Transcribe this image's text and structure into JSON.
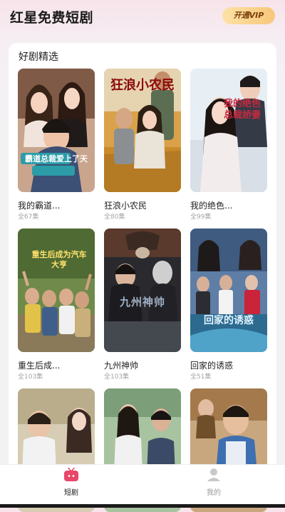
{
  "header": {
    "title": "红星免费短剧",
    "vip_label": "开通VIP"
  },
  "section": {
    "title": "好剧精选"
  },
  "items": [
    {
      "title": "我的霸道...",
      "count": "全67集",
      "poster_text": "霸道总裁爱上了天"
    },
    {
      "title": "狂浪小农民",
      "count": "全80集",
      "poster_text": "狂浪小农民"
    },
    {
      "title": "我的绝色...",
      "count": "全99集",
      "poster_text": "我的绝色总裁娇妻"
    },
    {
      "title": "重生后成...",
      "count": "全103集",
      "poster_text": "重生后成为汽车大亨"
    },
    {
      "title": "九州神帅",
      "count": "全103集",
      "poster_text": "九州神帅"
    },
    {
      "title": "回家的诱惑",
      "count": "全51集",
      "poster_text": "回家的诱惑"
    },
    {
      "title": "",
      "count": "",
      "poster_text": ""
    },
    {
      "title": "",
      "count": "",
      "poster_text": ""
    },
    {
      "title": "",
      "count": "",
      "poster_text": ""
    }
  ],
  "tabs": [
    {
      "label": "短剧",
      "icon": "tv-icon",
      "active": true,
      "color": "#e8466a"
    },
    {
      "label": "我的",
      "icon": "person-icon",
      "active": false,
      "color": "#999999"
    }
  ],
  "colors": {
    "accent": "#e8466a",
    "vip_start": "#fde2a6",
    "vip_end": "#f8c77a"
  }
}
